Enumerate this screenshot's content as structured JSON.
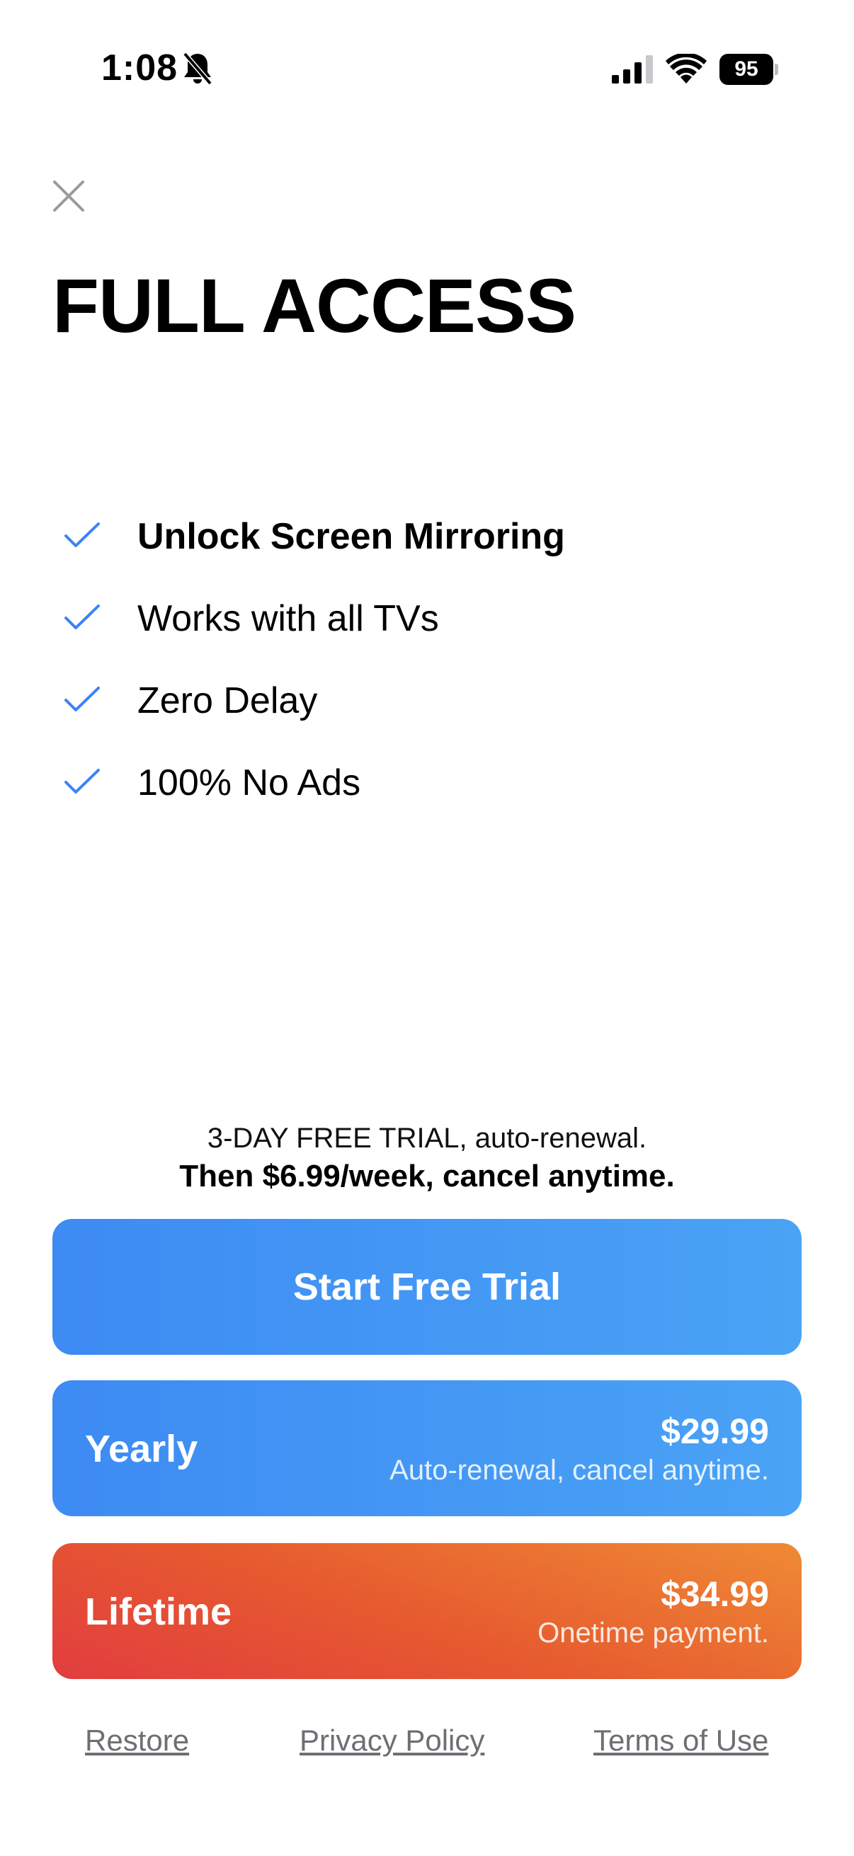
{
  "status_bar": {
    "time": "1:08",
    "battery_level": "95",
    "icons": [
      "bell-slash-icon",
      "cellular-signal-icon",
      "wifi-icon",
      "battery-icon"
    ]
  },
  "close_icon": "close-icon",
  "title": "FULL ACCESS",
  "features": [
    {
      "label": "Unlock Screen Mirroring",
      "icon": "checkmark-icon",
      "emphasis": true
    },
    {
      "label": "Works with all TVs",
      "icon": "checkmark-icon",
      "emphasis": false
    },
    {
      "label": "Zero Delay",
      "icon": "checkmark-icon",
      "emphasis": false
    },
    {
      "label": "100% No Ads",
      "icon": "checkmark-icon",
      "emphasis": false
    }
  ],
  "trial": {
    "line1": "3-DAY FREE TRIAL, auto-renewal.",
    "line2": "Then $6.99/week, cancel anytime."
  },
  "buttons": {
    "start_trial": "Start Free Trial",
    "yearly": {
      "name": "Yearly",
      "price": "$29.99",
      "note": "Auto-renewal, cancel anytime."
    },
    "lifetime": {
      "name": "Lifetime",
      "price": "$34.99",
      "note": "Onetime payment."
    }
  },
  "footer": {
    "restore": "Restore",
    "privacy": "Privacy Policy",
    "terms": "Terms of Use"
  },
  "colors": {
    "accent_blue": "#3d8bf3",
    "check_blue": "#3b82f6",
    "lifetime_red": "#e23d3f",
    "lifetime_orange": "#ef8a35",
    "link_gray": "#6e6e73"
  }
}
